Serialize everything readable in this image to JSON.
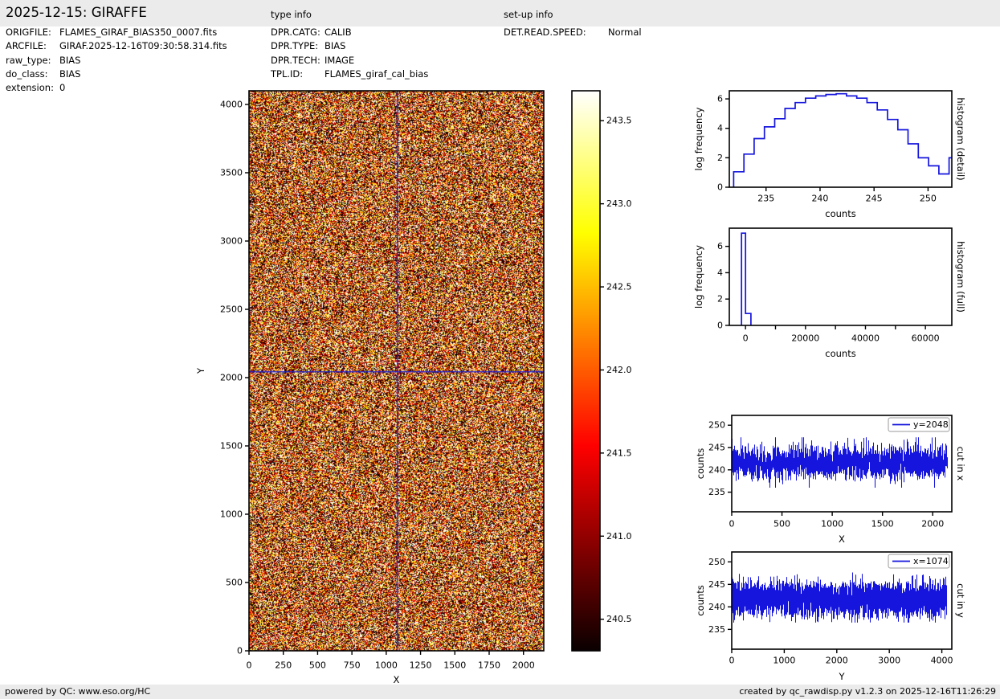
{
  "title": "2025-12-15: GIRAFFE",
  "sections": {
    "type_info_label": "type info",
    "setup_info_label": "set-up info"
  },
  "file_info": [
    {
      "label": "ORIGFILE:",
      "value": "FLAMES_GIRAF_BIAS350_0007.fits"
    },
    {
      "label": "ARCFILE:",
      "value": "GIRAF.2025-12-16T09:30:58.314.fits"
    },
    {
      "label": "raw_type:",
      "value": "BIAS"
    },
    {
      "label": "do_class:",
      "value": "BIAS"
    },
    {
      "label": "extension:",
      "value": "0"
    }
  ],
  "type_info": [
    {
      "label": "DPR.CATG:",
      "value": "CALIB"
    },
    {
      "label": "DPR.TYPE:",
      "value": "BIAS"
    },
    {
      "label": "DPR.TECH:",
      "value": "IMAGE"
    },
    {
      "label": "TPL.ID:",
      "value": "FLAMES_giraf_cal_bias"
    }
  ],
  "setup_info": [
    {
      "label": "DET.READ.SPEED:",
      "value": "Normal"
    }
  ],
  "footer": {
    "left": "powered by QC: www.eso.org/HC",
    "right": "created by qc_rawdisp.py v1.2.3 on 2025-12-16T11:26:29"
  },
  "colors": {
    "band": "#ebebeb",
    "line_blue": "#1515dd",
    "crosshair_blue": "#2222cc",
    "spine_black": "#000000",
    "legend_border": "#999999"
  },
  "chart_data": [
    {
      "id": "image",
      "type": "heatmap",
      "xlabel": "X",
      "ylabel": "Y",
      "xlim": [
        0,
        2148
      ],
      "ylim": [
        0,
        4100
      ],
      "xticks": [
        0,
        250,
        500,
        750,
        1000,
        1250,
        1500,
        1750,
        2000
      ],
      "yticks": [
        0,
        500,
        1000,
        1500,
        2000,
        2500,
        3000,
        3500,
        4000
      ],
      "colormap": "hot",
      "zrange": [
        240.31,
        243.68
      ],
      "noise": {
        "mean": 241.8,
        "sigma": 1.9,
        "seed": 42
      },
      "crosshair": {
        "x": 1074,
        "y": 2048
      }
    },
    {
      "id": "colorbar",
      "type": "colorbar",
      "colormap": "hot",
      "range": [
        240.31,
        243.68
      ],
      "tick_values": [
        240.5,
        241.0,
        241.5,
        242.0,
        242.5,
        243.0,
        243.5
      ],
      "tick_labels": [
        "240.5",
        "241.0",
        "241.5",
        "242.0",
        "242.5",
        "243.0",
        "243.5"
      ]
    },
    {
      "id": "hist_detail",
      "type": "bar",
      "side_label": "histogram (detail)",
      "xlabel": "counts",
      "ylabel": "log frequency",
      "xlim": [
        231.6,
        252.2
      ],
      "ylim": [
        0,
        6.55
      ],
      "xticks": [
        235,
        240,
        245,
        250
      ],
      "yticks": [
        0,
        2,
        4,
        6
      ],
      "bin_start": 232.0,
      "bin_width": 0.95,
      "log_frequency": [
        1.05,
        2.25,
        3.3,
        4.1,
        4.65,
        5.35,
        5.75,
        6.05,
        6.2,
        6.3,
        6.35,
        6.2,
        6.05,
        5.75,
        5.25,
        4.6,
        3.9,
        2.95,
        2.0,
        1.45,
        0.9,
        2.0
      ]
    },
    {
      "id": "hist_full",
      "type": "bar",
      "side_label": "histogram (full)",
      "xlabel": "counts",
      "ylabel": "log frequency",
      "xlim": [
        -5400,
        68800
      ],
      "ylim": [
        0,
        7.38
      ],
      "xticks": [
        0,
        20000,
        40000,
        60000
      ],
      "xticks_minor": [
        10000,
        30000,
        50000
      ],
      "yticks": [
        0,
        2,
        4,
        6
      ],
      "bins": [
        {
          "x0": -1340,
          "x1": 0,
          "v": 7.0
        },
        {
          "x0": 0,
          "x1": 1800,
          "v": 0.9
        }
      ]
    },
    {
      "id": "cut_x",
      "type": "line",
      "legend": "y=2048",
      "side_label": "cut in x",
      "xlabel": "X",
      "ylabel": "counts",
      "xlim": [
        0,
        2190
      ],
      "ylim": [
        230.6,
        252.2
      ],
      "xticks": [
        0,
        500,
        1000,
        1500,
        2000
      ],
      "yticks": [
        235,
        240,
        245,
        250
      ],
      "series": {
        "n": 2148,
        "mean": 241.7,
        "sigma": 1.9,
        "clip_min": 236.0,
        "clip_max": 247.3,
        "seed": 7
      }
    },
    {
      "id": "cut_y",
      "type": "line",
      "legend": "x=1074",
      "side_label": "cut in y",
      "xlabel": "Y",
      "ylabel": "counts",
      "xlim": [
        0,
        4190
      ],
      "ylim": [
        230.6,
        252.2
      ],
      "xticks": [
        0,
        1000,
        2000,
        3000,
        4000
      ],
      "yticks": [
        235,
        240,
        245,
        250
      ],
      "series": {
        "n": 4096,
        "mean": 241.7,
        "sigma": 1.9,
        "clip_min": 236.5,
        "clip_max": 248.2,
        "seed": 13
      }
    }
  ]
}
